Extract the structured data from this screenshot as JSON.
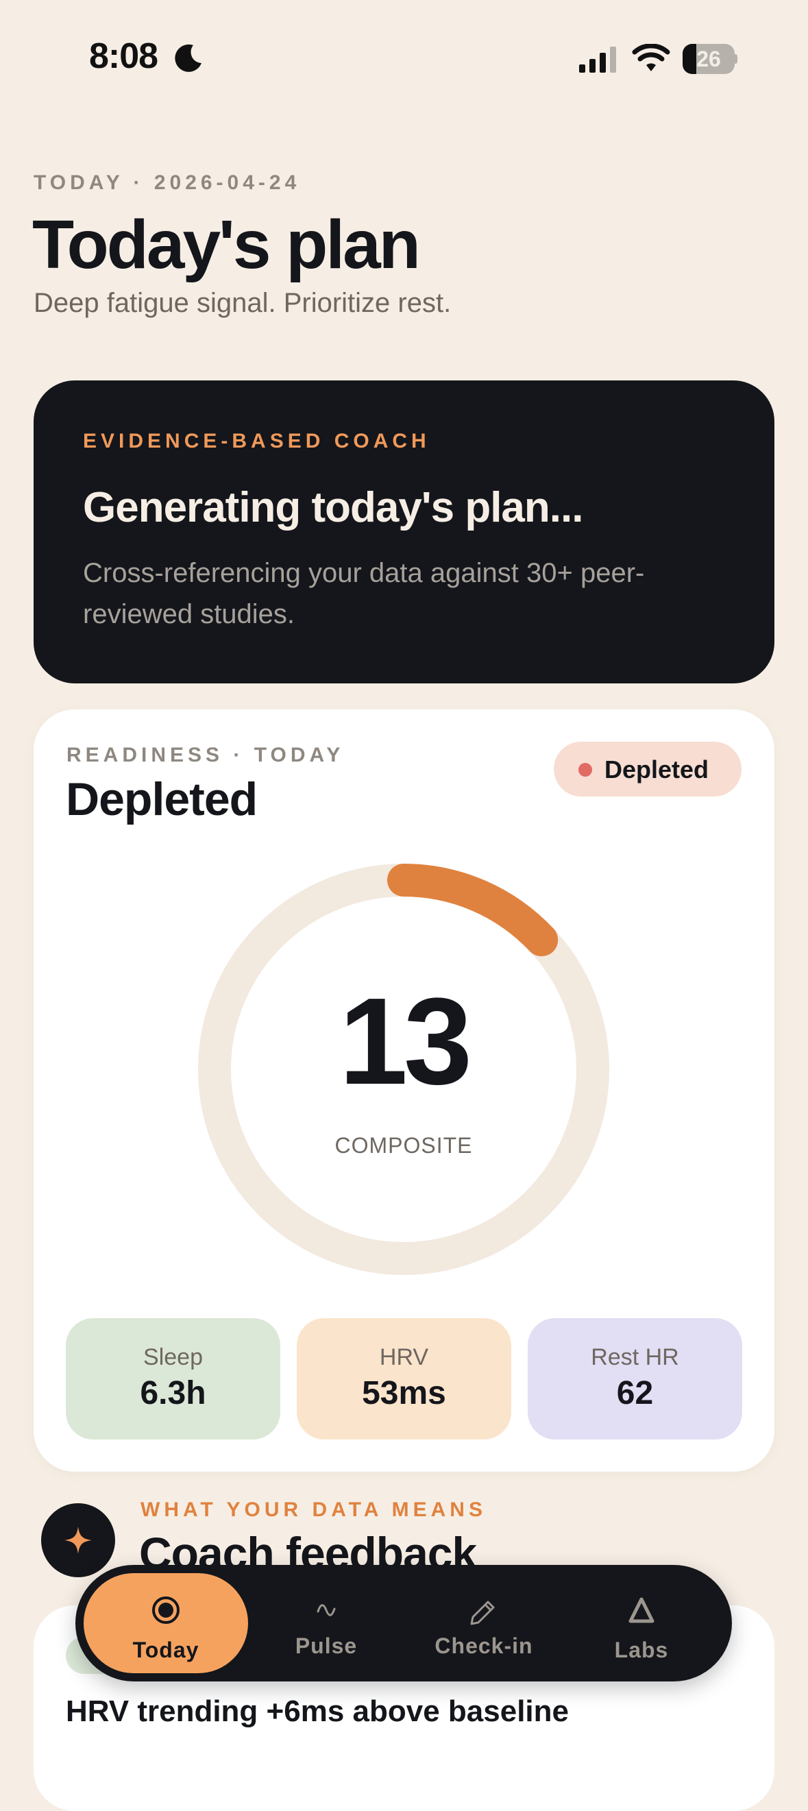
{
  "status_bar": {
    "time": "8:08",
    "battery_level": "26",
    "battery_fraction": 0.26
  },
  "header": {
    "eyebrow": "TODAY · 2026-04-24",
    "title": "Today's plan",
    "subtitle": "Deep fatigue signal. Prioritize rest."
  },
  "coach_card": {
    "eyebrow": "EVIDENCE-BASED COACH",
    "heading": "Generating today's plan...",
    "body": "Cross-referencing your data against 30+ peer-reviewed studies."
  },
  "readiness": {
    "eyebrow": "READINESS · TODAY",
    "state": "Depleted",
    "badge_label": "Depleted",
    "score": "13",
    "score_fraction": 0.13,
    "score_caption": "COMPOSITE",
    "metrics": [
      {
        "label": "Sleep",
        "value": "6.3h"
      },
      {
        "label": "HRV",
        "value": "53ms"
      },
      {
        "label": "Rest HR",
        "value": "62"
      }
    ]
  },
  "feedback": {
    "eyebrow": "WHAT YOUR DATA MEANS",
    "title": "Coach feedback",
    "insight_title": "HRV trending +6ms above baseline"
  },
  "tab_bar": {
    "tabs": [
      {
        "label": "Today",
        "icon": "target-icon",
        "active": true
      },
      {
        "label": "Pulse",
        "icon": "wave-icon",
        "active": false
      },
      {
        "label": "Check-in",
        "icon": "pencil-icon",
        "active": false
      },
      {
        "label": "Labs",
        "icon": "flask-icon",
        "active": false
      }
    ]
  },
  "colors": {
    "background": "#f6eee4",
    "accent": "#e0823f",
    "dark": "#14161b",
    "gauge_track": "#f2e9df",
    "status_depleted": "#e06b63"
  }
}
